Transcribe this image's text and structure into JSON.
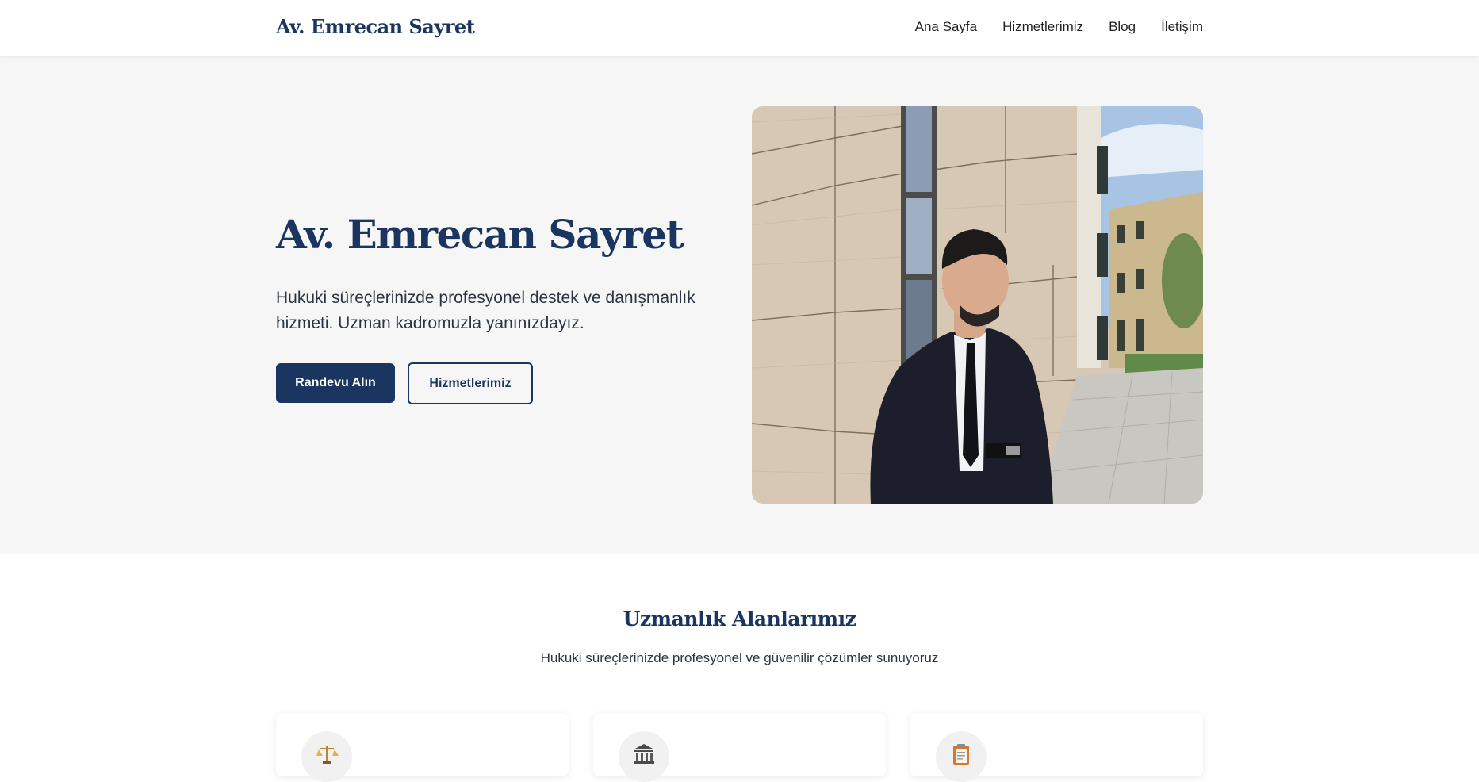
{
  "nav": {
    "brand": "Av. Emrecan Sayret",
    "links": [
      "Ana Sayfa",
      "Hizmetlerimiz",
      "Blog",
      "İletişim"
    ]
  },
  "hero": {
    "title": "Av. Emrecan Sayret",
    "description": "Hukuki süreçlerinizde profesyonel destek ve danışmanlık hizmeti. Uzman kadromuzla yanınızdayız.",
    "primary_button": "Randevu Alın",
    "secondary_button": "Hizmetlerimiz",
    "photo_icon": "portrait-photo"
  },
  "expertise": {
    "title": "Uzmanlık Alanlarımız",
    "subtitle": "Hukuki süreçlerinizde profesyonel ve güvenilir çözümler sunuyoruz",
    "cards": [
      {
        "icon": "scales-icon"
      },
      {
        "icon": "courthouse-icon"
      },
      {
        "icon": "clipboard-icon"
      }
    ]
  },
  "colors": {
    "brand_navy": "#1a3660",
    "hero_background": "#f6f6f6",
    "text_dark": "#2b3442"
  }
}
